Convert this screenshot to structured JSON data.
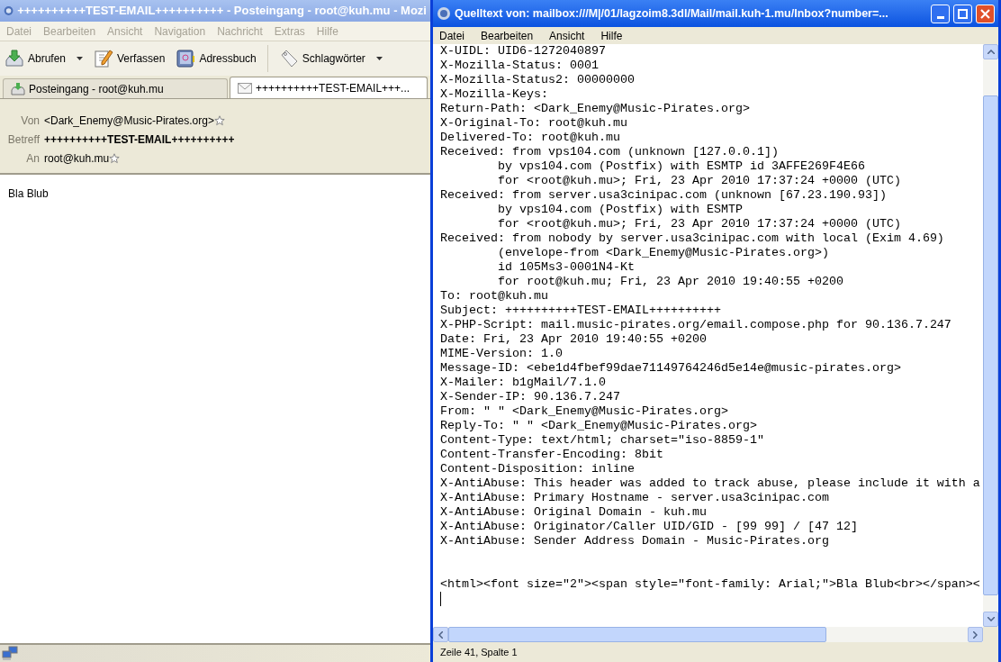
{
  "main_window": {
    "title": "++++++++++TEST-EMAIL++++++++++ - Posteingang - root@kuh.mu - Mozi",
    "menu": [
      {
        "label": "Datei"
      },
      {
        "label": "Bearbeiten"
      },
      {
        "label": "Ansicht"
      },
      {
        "label": "Navigation"
      },
      {
        "label": "Nachricht"
      },
      {
        "label": "Extras"
      },
      {
        "label": "Hilfe"
      }
    ],
    "toolbar": [
      {
        "kind": "get",
        "label": "Abrufen",
        "dropdown": true
      },
      {
        "kind": "compose",
        "label": "Verfassen",
        "dropdown": false
      },
      {
        "kind": "addressbook",
        "label": "Adressbuch",
        "dropdown": false
      },
      {
        "kind": "tags",
        "label": "Schlagwörter",
        "dropdown": true
      }
    ],
    "tabs": [
      {
        "kind": "inbox",
        "label": "Posteingang - root@kuh.mu",
        "selected": false
      },
      {
        "kind": "message",
        "label": "++++++++++TEST-EMAIL+++...",
        "selected": true
      }
    ],
    "headers": [
      {
        "kind": "address",
        "label": "Von",
        "value": "<Dark_Enemy@Music-Pirates.org>"
      },
      {
        "kind": "subject",
        "label": "Betreff",
        "value": "++++++++++TEST-EMAIL++++++++++"
      },
      {
        "kind": "address",
        "label": "An",
        "value": "root@kuh.mu"
      }
    ],
    "body": "Bla Blub"
  },
  "source_window": {
    "title": "Quelltext von: mailbox:///M|/01/lagzoim8.3dl/Mail/mail.kuh-1.mu/Inbox?number=...",
    "menu": [
      {
        "label": "Datei"
      },
      {
        "label": "Bearbeiten"
      },
      {
        "label": "Ansicht"
      },
      {
        "label": "Hilfe"
      }
    ],
    "header_lines": [
      "X-UIDL: UID6-1272040897",
      "X-Mozilla-Status: 0001",
      "X-Mozilla-Status2: 00000000",
      "X-Mozilla-Keys:",
      "Return-Path: <Dark_Enemy@Music-Pirates.org>",
      "X-Original-To: root@kuh.mu",
      "Delivered-To: root@kuh.mu",
      "Received: from vps104.com (unknown [127.0.0.1])",
      "        by vps104.com (Postfix) with ESMTP id 3AFFE269F4E66",
      "        for <root@kuh.mu>; Fri, 23 Apr 2010 17:37:24 +0000 (UTC)",
      "Received: from server.usa3cinipac.com (unknown [67.23.190.93])",
      "        by vps104.com (Postfix) with ESMTP",
      "        for <root@kuh.mu>; Fri, 23 Apr 2010 17:37:24 +0000 (UTC)",
      "Received: from nobody by server.usa3cinipac.com with local (Exim 4.69)",
      "        (envelope-from <Dark_Enemy@Music-Pirates.org>)",
      "        id 105Ms3-0001N4-Kt",
      "        for root@kuh.mu; Fri, 23 Apr 2010 19:40:55 +0200",
      "To: root@kuh.mu",
      "Subject: ++++++++++TEST-EMAIL++++++++++",
      "X-PHP-Script: mail.music-pirates.org/email.compose.php for 90.136.7.247",
      "Date: Fri, 23 Apr 2010 19:40:55 +0200",
      "MIME-Version: 1.0",
      "Message-ID: <ebe1d4fbef99dae71149764246d5e14e@music-pirates.org>",
      "X-Mailer: b1gMail/7.1.0",
      "X-Sender-IP: 90.136.7.247",
      "From: \" \" <Dark_Enemy@Music-Pirates.org>",
      "Reply-To: \" \" <Dark_Enemy@Music-Pirates.org>",
      "Content-Type: text/html; charset=\"iso-8859-1\"",
      "Content-Transfer-Encoding: 8bit",
      "Content-Disposition: inline",
      "X-AntiAbuse: This header was added to track abuse, please include it with a",
      "X-AntiAbuse: Primary Hostname - server.usa3cinipac.com",
      "X-AntiAbuse: Original Domain - kuh.mu",
      "X-AntiAbuse: Originator/Caller UID/GID - [99 99] / [47 12]",
      "X-AntiAbuse: Sender Address Domain - Music-Pirates.org"
    ],
    "body_lines": [
      "<html><font size=\"2\"><span style=\"font-family: Arial;\">Bla Blub<br></span><"
    ],
    "status": "Zeile 41, Spalte 1"
  }
}
